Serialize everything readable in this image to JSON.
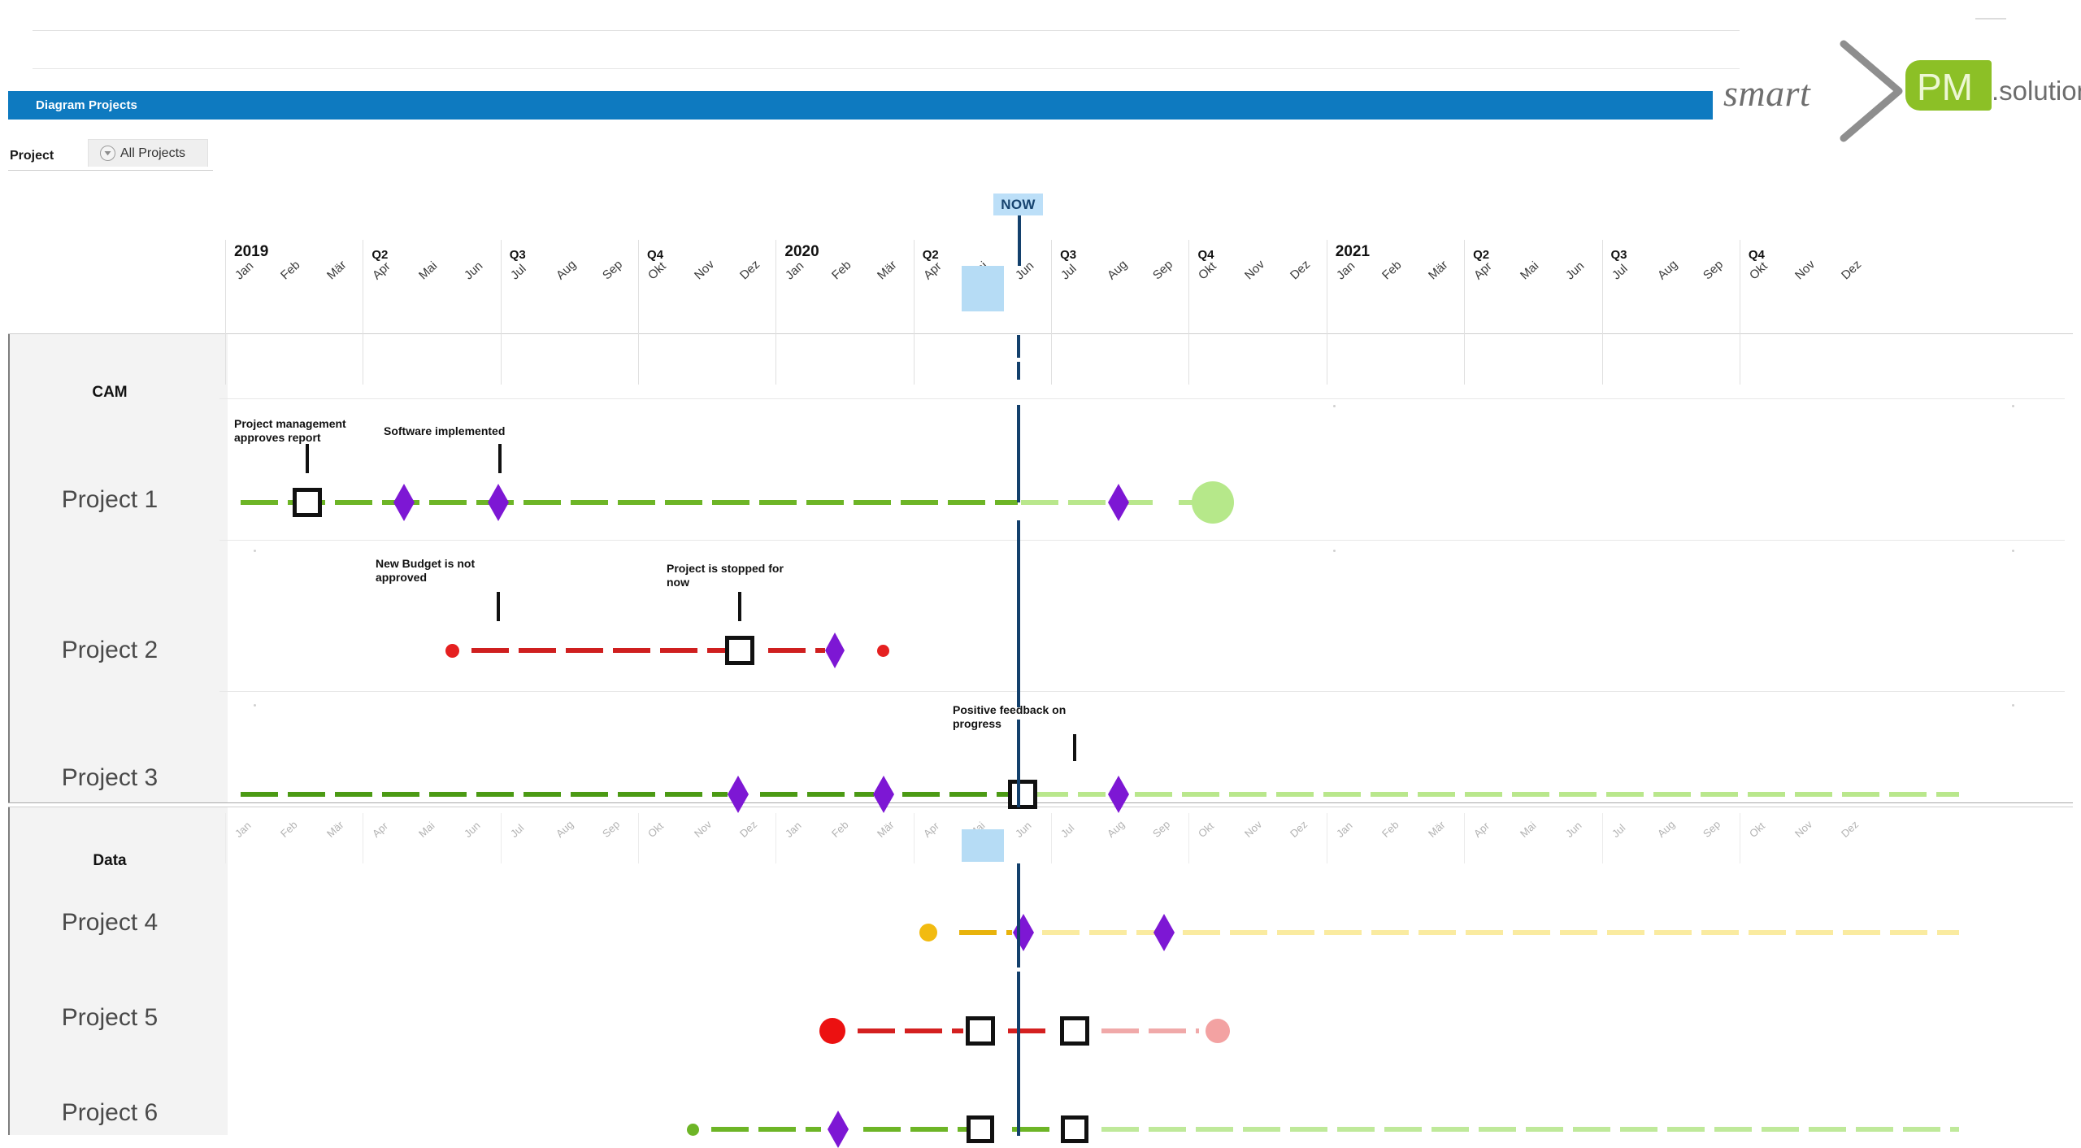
{
  "window": {
    "title_bar": "Diagram Projects"
  },
  "filter": {
    "label": "Project",
    "dropdown_value": "All Projects",
    "dropdown_icon": "circle-chevron-down-icon"
  },
  "brand": {
    "word1": "smart",
    "chevron": "chevron-right-icon",
    "badge": "PM",
    "word2": ".solutions",
    "badge_color": "#8cc026"
  },
  "now_marker": {
    "label": "NOW",
    "month": "Mai",
    "year": "2020",
    "color": "#13406c",
    "badge_bg": "#bcdff8",
    "highlight_bg": "#b6dcf5"
  },
  "timeline": {
    "start_year": 2019,
    "end_year": 2021,
    "months": [
      "Jan",
      "Feb",
      "Mär",
      "Apr",
      "Mai",
      "Jun",
      "Jul",
      "Aug",
      "Sep",
      "Okt",
      "Nov",
      "Dez"
    ],
    "year_labels": [
      "2019",
      "2020",
      "2021"
    ],
    "quarter_labels": [
      "Q2",
      "Q3",
      "Q4"
    ],
    "header_cells": [
      {
        "group": "2019",
        "type": "year"
      },
      {
        "group": "Q2",
        "type": "quarter"
      },
      {
        "group": "Q3",
        "type": "quarter"
      },
      {
        "group": "Q4",
        "type": "quarter"
      },
      {
        "group": "2020",
        "type": "year"
      },
      {
        "group": "Q2",
        "type": "quarter"
      },
      {
        "group": "Q3",
        "type": "quarter"
      },
      {
        "group": "Q4",
        "type": "quarter"
      },
      {
        "group": "2021",
        "type": "year"
      },
      {
        "group": "Q2",
        "type": "quarter"
      },
      {
        "group": "Q3",
        "type": "quarter"
      },
      {
        "group": "Q4",
        "type": "quarter"
      }
    ]
  },
  "sections": [
    {
      "id": "cam",
      "header": "CAM",
      "rows": [
        {
          "label": "Project 1",
          "color": "#6db526",
          "future_color": "#b9e78c",
          "annotations": [
            {
              "text": "Project management\napproves report",
              "month_index": 1
            },
            {
              "text": "Software implemented",
              "month_index": 4
            }
          ]
        },
        {
          "label": "Project 2",
          "color": "#cf1f1f",
          "future_color": "#f3a1a1",
          "annotations": [
            {
              "text": "New Budget is not\napproved",
              "month_index": 4
            },
            {
              "text": "Project is stopped for\nnow",
              "month_index": 10
            }
          ]
        },
        {
          "label": "Project 3",
          "color": "#4b9a14",
          "future_color": "#b9e78c",
          "annotations": [
            {
              "text": "Positive feedback on\nprogress",
              "month_index": 17
            }
          ]
        }
      ]
    },
    {
      "id": "data",
      "header": "Data",
      "rows": [
        {
          "label": "Project 4",
          "color": "#e8b30c",
          "future_color": "#faeea0",
          "annotations": []
        },
        {
          "label": "Project 5",
          "color": "#d42020",
          "future_color": "#f0a9a9",
          "annotations": []
        },
        {
          "label": "Project 6",
          "color": "#6db526",
          "future_color": "#bfe99a",
          "annotations": []
        }
      ]
    }
  ],
  "legend_shapes": {
    "milestone": "square-outline-marker",
    "event": "purple-diamond-marker",
    "start_end": "filled-circle-marker"
  },
  "chart_data": {
    "type": "gantt-timeline",
    "title": "Diagram Projects",
    "x_axis": {
      "unit": "month",
      "start": "2019-01",
      "end": "2021-12",
      "tick_labels": [
        "Jan",
        "Feb",
        "Mär",
        "Apr",
        "Mai",
        "Jun",
        "Jul",
        "Aug",
        "Sep",
        "Okt",
        "Nov",
        "Dez"
      ],
      "group_labels": [
        "2019",
        "Q2",
        "Q3",
        "Q4",
        "2020",
        "Q2",
        "Q3",
        "Q4",
        "2021",
        "Q2",
        "Q3",
        "Q4"
      ]
    },
    "now": {
      "label": "NOW",
      "at": "2020-05"
    },
    "tasks": [
      {
        "name": "Project 1",
        "section": "CAM",
        "color": "#6db526",
        "bar": {
          "start": "2019-01",
          "end": "2020-05"
        },
        "forecast": {
          "start": "2020-05",
          "end": "2020-10"
        },
        "markers": [
          {
            "type": "square",
            "at": "2019-02",
            "label": "Project management approves report"
          },
          {
            "type": "diamond",
            "at": "2019-04"
          },
          {
            "type": "diamond",
            "at": "2019-05",
            "label": "Software implemented"
          },
          {
            "type": "diamond",
            "at": "2020-07"
          },
          {
            "type": "circle",
            "at": "2020-09",
            "size": "large",
            "color": "#b9e78c"
          }
        ]
      },
      {
        "name": "Project 2",
        "section": "CAM",
        "color": "#cf1f1f",
        "bar": {
          "start": "2019-05",
          "end": "2020-01"
        },
        "markers": [
          {
            "type": "circle",
            "at": "2019-05",
            "size": "small",
            "color": "#e02020"
          },
          {
            "type": "square",
            "at": "2019-11",
            "label": "Project is stopped for now"
          },
          {
            "type": "diamond",
            "at": "2020-00"
          },
          {
            "type": "circle",
            "at": "2020-01",
            "size": "small",
            "color": "#e02020"
          }
        ],
        "annotations": [
          {
            "text": "New Budget is not approved",
            "at": "2019-06"
          }
        ]
      },
      {
        "name": "Project 3",
        "section": "CAM",
        "color": "#4b9a14",
        "bar": {
          "start": "2019-01",
          "end": "2020-05"
        },
        "forecast": {
          "start": "2020-05",
          "end": "2021-12"
        },
        "markers": [
          {
            "type": "diamond",
            "at": "2019-11"
          },
          {
            "type": "diamond",
            "at": "2020-01"
          },
          {
            "type": "square",
            "at": "2020-05",
            "label": "Positive feedback on progress"
          },
          {
            "type": "diamond",
            "at": "2020-07"
          }
        ]
      },
      {
        "name": "Project 4",
        "section": "Data",
        "color": "#e8b30c",
        "bar": {
          "start": "2020-02",
          "end": "2020-05"
        },
        "forecast": {
          "start": "2020-05",
          "end": "2021-12"
        },
        "markers": [
          {
            "type": "circle",
            "at": "2020-02",
            "size": "small",
            "color": "#f2b90a"
          },
          {
            "type": "diamond",
            "at": "2020-05"
          },
          {
            "type": "diamond",
            "at": "2020-08"
          }
        ]
      },
      {
        "name": "Project 5",
        "section": "Data",
        "color": "#d42020",
        "bar": {
          "start": "2020-01",
          "end": "2020-07"
        },
        "forecast": {
          "start": "2020-07",
          "end": "2020-09"
        },
        "markers": [
          {
            "type": "circle",
            "at": "2020-01",
            "size": "large",
            "color": "#ec1111"
          },
          {
            "type": "square",
            "at": "2020-04"
          },
          {
            "type": "square",
            "at": "2020-06"
          },
          {
            "type": "circle",
            "at": "2020-09",
            "size": "large",
            "color": "#f0a0a0"
          }
        ]
      },
      {
        "name": "Project 6",
        "section": "Data",
        "color": "#6db526",
        "bar": {
          "start": "2019-11",
          "end": "2020-06"
        },
        "forecast": {
          "start": "2020-06",
          "end": "2021-12"
        },
        "markers": [
          {
            "type": "circle",
            "at": "2019-11",
            "size": "small",
            "color": "#6db526"
          },
          {
            "type": "diamond",
            "at": "2020-01"
          },
          {
            "type": "square",
            "at": "2020-04"
          },
          {
            "type": "square",
            "at": "2020-06"
          }
        ]
      }
    ]
  }
}
